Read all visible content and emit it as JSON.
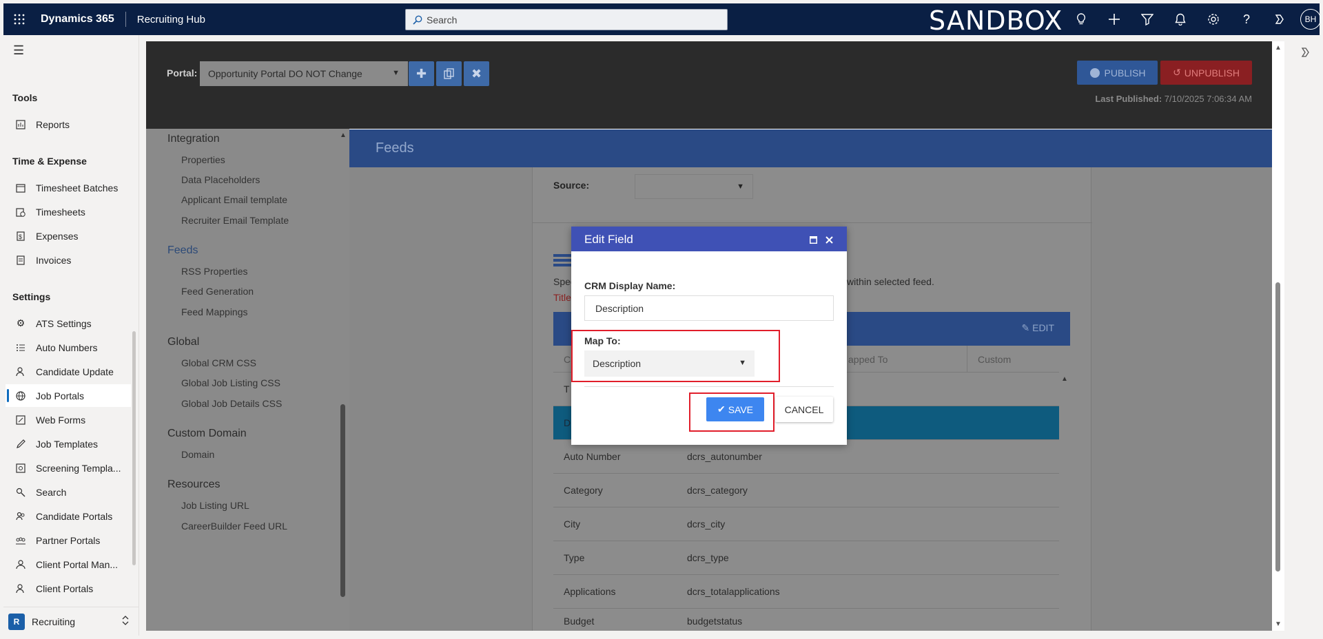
{
  "topbar": {
    "brand": "Dynamics 365",
    "app": "Recruiting Hub",
    "search_placeholder": "Search",
    "environment": "SANDBOX",
    "avatar": "BH"
  },
  "leftnav": {
    "groups": {
      "tools": "Tools",
      "time_expense": "Time & Expense",
      "settings": "Settings"
    },
    "items": {
      "reports": "Reports",
      "timesheet_batches": "Timesheet Batches",
      "timesheets": "Timesheets",
      "expenses": "Expenses",
      "invoices": "Invoices",
      "ats_settings": "ATS Settings",
      "auto_numbers": "Auto Numbers",
      "candidate_update": "Candidate Update",
      "job_portals": "Job Portals",
      "web_forms": "Web Forms",
      "job_templates": "Job Templates",
      "screening_templates": "Screening Templa...",
      "search": "Search",
      "candidate_portals": "Candidate Portals",
      "partner_portals": "Partner Portals",
      "client_portal_man": "Client Portal Man...",
      "client_portals": "Client Portals"
    },
    "area": {
      "badge": "R",
      "label": "Recruiting"
    }
  },
  "portalbar": {
    "label": "Portal:",
    "selected": "Opportunity Portal DO NOT Change",
    "publish": "PUBLISH",
    "unpublish": "UNPUBLISH",
    "last_published_label": "Last Published:",
    "last_published_value": "7/10/2025 7:06:34 AM"
  },
  "portalnav": {
    "integration": "Integration",
    "properties": "Properties",
    "data_placeholders": "Data Placeholders",
    "applicant_email": "Applicant Email template",
    "recruiter_email": "Recruiter Email Template",
    "feeds": "Feeds",
    "rss_properties": "RSS Properties",
    "feed_generation": "Feed Generation",
    "feed_mappings": "Feed Mappings",
    "global": "Global",
    "global_crm_css": "Global CRM CSS",
    "global_job_listing_css": "Global Job Listing CSS",
    "global_job_details_css": "Global Job Details CSS",
    "custom_domain": "Custom Domain",
    "domain": "Domain",
    "resources": "Resources",
    "job_listing_url": "Job Listing URL",
    "careerbuilder_feed_url": "CareerBuilder Feed URL"
  },
  "feeds": {
    "title": "Feeds",
    "source_label": "Source:",
    "spec_left": "Spec",
    "spec_right": "within selected feed.",
    "title_red": "Title",
    "edit": "EDIT",
    "columns": {
      "c1": "C",
      "mapped_to": "apped To",
      "custom": "Custom"
    },
    "rows": [
      {
        "field": "T",
        "mapped": ""
      },
      {
        "field": "D",
        "mapped": ""
      },
      {
        "field": "Auto Number",
        "mapped": "dcrs_autonumber"
      },
      {
        "field": "Category",
        "mapped": "dcrs_category"
      },
      {
        "field": "City",
        "mapped": "dcrs_city"
      },
      {
        "field": "Type",
        "mapped": "dcrs_type"
      },
      {
        "field": "Applications",
        "mapped": "dcrs_totalapplications"
      },
      {
        "field": "Budget",
        "mapped": "budgetstatus"
      }
    ]
  },
  "dialog": {
    "title": "Edit Field",
    "crm_label": "CRM Display Name:",
    "crm_value": "Description",
    "map_label": "Map To:",
    "map_value": "Description",
    "save": "SAVE",
    "cancel": "CANCEL"
  },
  "colors": {
    "topbar": "#0a1f44",
    "dialog_header": "#3f51b5",
    "save_button": "#3d86f0",
    "highlight": "#e11d2a"
  }
}
